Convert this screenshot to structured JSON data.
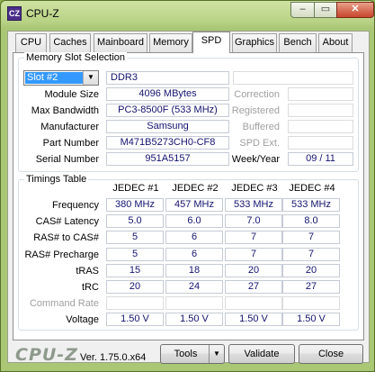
{
  "window": {
    "title": "CPU-Z",
    "app_icon_text": "CZ",
    "min_glyph": "–",
    "max_glyph": "▭",
    "close_glyph": "✕"
  },
  "tabs": [
    {
      "label": "CPU",
      "active": false
    },
    {
      "label": "Caches",
      "active": false
    },
    {
      "label": "Mainboard",
      "active": false
    },
    {
      "label": "Memory",
      "active": false
    },
    {
      "label": "SPD",
      "active": true
    },
    {
      "label": "Graphics",
      "active": false
    },
    {
      "label": "Bench",
      "active": false
    },
    {
      "label": "About",
      "active": false
    }
  ],
  "slot": {
    "group_title": "Memory Slot Selection",
    "selected_slot": "Slot #2",
    "memory_type": "DDR3",
    "labels": {
      "module_size": "Module Size",
      "max_bandwidth": "Max Bandwidth",
      "manufacturer": "Manufacturer",
      "part_number": "Part Number",
      "serial_number": "Serial Number",
      "correction": "Correction",
      "registered": "Registered",
      "buffered": "Buffered",
      "spd_ext": "SPD Ext.",
      "week_year": "Week/Year"
    },
    "values": {
      "module_size": "4096 MBytes",
      "max_bandwidth": "PC3-8500F (533 MHz)",
      "manufacturer": "Samsung",
      "part_number": "M471B5273CH0-CF8",
      "serial_number": "951A5157",
      "week_year": "09 / 11"
    }
  },
  "timings": {
    "group_title": "Timings Table",
    "columns": [
      "JEDEC #1",
      "JEDEC #2",
      "JEDEC #3",
      "JEDEC #4"
    ],
    "rows": [
      {
        "label": "Frequency",
        "values": [
          "380 MHz",
          "457 MHz",
          "533 MHz",
          "533 MHz"
        ],
        "disabled": false
      },
      {
        "label": "CAS# Latency",
        "values": [
          "5.0",
          "6.0",
          "7.0",
          "8.0"
        ],
        "disabled": false
      },
      {
        "label": "RAS# to CAS#",
        "values": [
          "5",
          "6",
          "7",
          "7"
        ],
        "disabled": false
      },
      {
        "label": "RAS# Precharge",
        "values": [
          "5",
          "6",
          "7",
          "7"
        ],
        "disabled": false
      },
      {
        "label": "tRAS",
        "values": [
          "15",
          "18",
          "20",
          "20"
        ],
        "disabled": false
      },
      {
        "label": "tRC",
        "values": [
          "20",
          "24",
          "27",
          "27"
        ],
        "disabled": false
      },
      {
        "label": "Command Rate",
        "values": [
          "",
          "",
          "",
          ""
        ],
        "disabled": true
      },
      {
        "label": "Voltage",
        "values": [
          "1.50 V",
          "1.50 V",
          "1.50 V",
          "1.50 V"
        ],
        "disabled": false
      }
    ]
  },
  "footer": {
    "logo": "CPU-Z",
    "version": "Ver. 1.75.0.x64",
    "tools_label": "Tools",
    "validate_label": "Validate",
    "close_label": "Close"
  }
}
